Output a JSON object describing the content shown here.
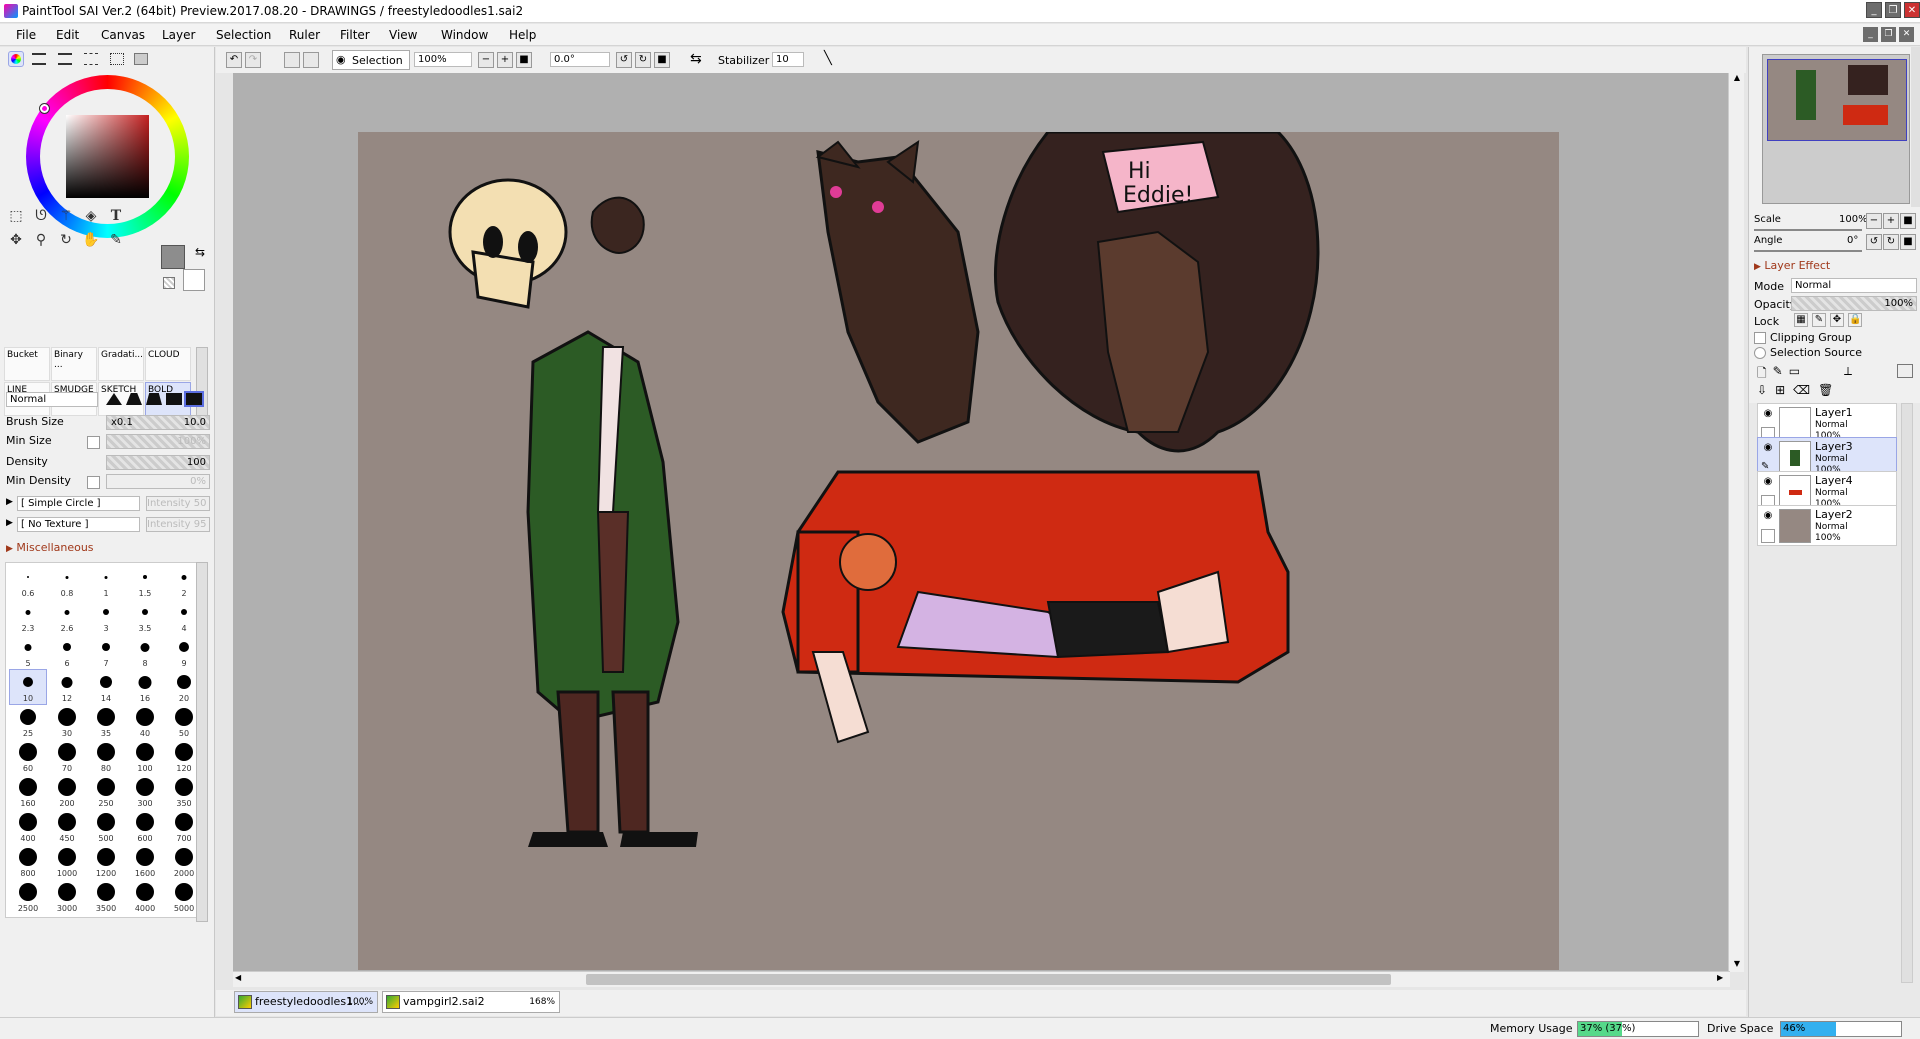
{
  "window": {
    "title": "PaintTool SAI Ver.2 (64bit) Preview.2017.08.20 - DRAWINGS / freestyledoodles1.sai2",
    "controls": [
      "_",
      "❐",
      "✕"
    ]
  },
  "menubar": {
    "items": [
      "File",
      "Edit",
      "Canvas",
      "Layer",
      "Selection",
      "Ruler",
      "Filter",
      "View",
      "Window",
      "Help"
    ],
    "mdi_controls": [
      "_",
      "❐",
      "✕"
    ]
  },
  "toolbar": {
    "selection_label": "Selection",
    "zoom": "100%",
    "angle": "0.0°",
    "stabilizer_label": "Stabilizer",
    "stabilizer_value": "10"
  },
  "brushes": [
    {
      "name": "Bucket",
      "selected": false
    },
    {
      "name": "Binary ...",
      "selected": false
    },
    {
      "name": "Gradati...",
      "selected": false
    },
    {
      "name": "CLOUD",
      "selected": false
    },
    {
      "name": "LINE",
      "selected": false
    },
    {
      "name": "SMUDGE",
      "selected": false
    },
    {
      "name": "SKETCH",
      "selected": false
    },
    {
      "name": "BOLD",
      "selected": true
    }
  ],
  "brush_settings": {
    "blend_mode": "Normal",
    "brush_size_label": "Brush Size",
    "brush_size_mult": "x0.1",
    "brush_size_value": "10.0",
    "min_size_label": "Min Size",
    "min_size_value": "100%",
    "density_label": "Density",
    "density_value": "100",
    "min_density_label": "Min Density",
    "min_density_value": "0%",
    "shape": "[ Simple Circle ]",
    "shape_intensity": "Intensity 50",
    "texture": "[ No Texture ]",
    "texture_intensity": "Intensity 95",
    "misc_label": "Miscellaneous"
  },
  "brush_sizes": [
    "0.6",
    "0.8",
    "1",
    "1.5",
    "2",
    "2.3",
    "2.6",
    "3",
    "3.5",
    "4",
    "5",
    "6",
    "7",
    "8",
    "9",
    "10",
    "12",
    "14",
    "16",
    "20",
    "25",
    "30",
    "35",
    "40",
    "50",
    "60",
    "70",
    "80",
    "100",
    "120",
    "160",
    "200",
    "250",
    "300",
    "350",
    "400",
    "450",
    "500",
    "600",
    "700",
    "800",
    "1000",
    "1200",
    "1600",
    "2000",
    "2500",
    "3000",
    "3500",
    "4000",
    "5000"
  ],
  "selected_brush_size": "10",
  "canvas": {
    "speech_text_1": "Hi",
    "speech_text_2": "Eddie!"
  },
  "navigator": {
    "scale_label": "Scale",
    "scale_value": "100%",
    "angle_label": "Angle",
    "angle_value": "0°"
  },
  "layer_panel": {
    "effect_label": "Layer Effect",
    "mode_label": "Mode",
    "mode_value": "Normal",
    "opacity_label": "Opacity",
    "opacity_value": "100%",
    "lock_label": "Lock",
    "clipping_label": "Clipping Group",
    "selection_source_label": "Selection Source",
    "layers": [
      {
        "name": "Layer1",
        "mode": "Normal",
        "opacity": "100%",
        "selected": false
      },
      {
        "name": "Layer3",
        "mode": "Normal",
        "opacity": "100%",
        "selected": true
      },
      {
        "name": "Layer4",
        "mode": "Normal",
        "opacity": "100%",
        "selected": false
      },
      {
        "name": "Layer2",
        "mode": "Normal",
        "opacity": "100%",
        "selected": false
      }
    ]
  },
  "tabs": [
    {
      "name": "freestyledoodles1....",
      "zoom": "100%",
      "selected": true
    },
    {
      "name": "vampgirl2.sai2",
      "zoom": "168%",
      "selected": false
    }
  ],
  "status": {
    "memory_label": "Memory Usage",
    "memory_value": "37% (37%)",
    "memory_fraction": 0.37,
    "drive_label": "Drive Space",
    "drive_value": "46%",
    "drive_fraction": 0.46
  }
}
